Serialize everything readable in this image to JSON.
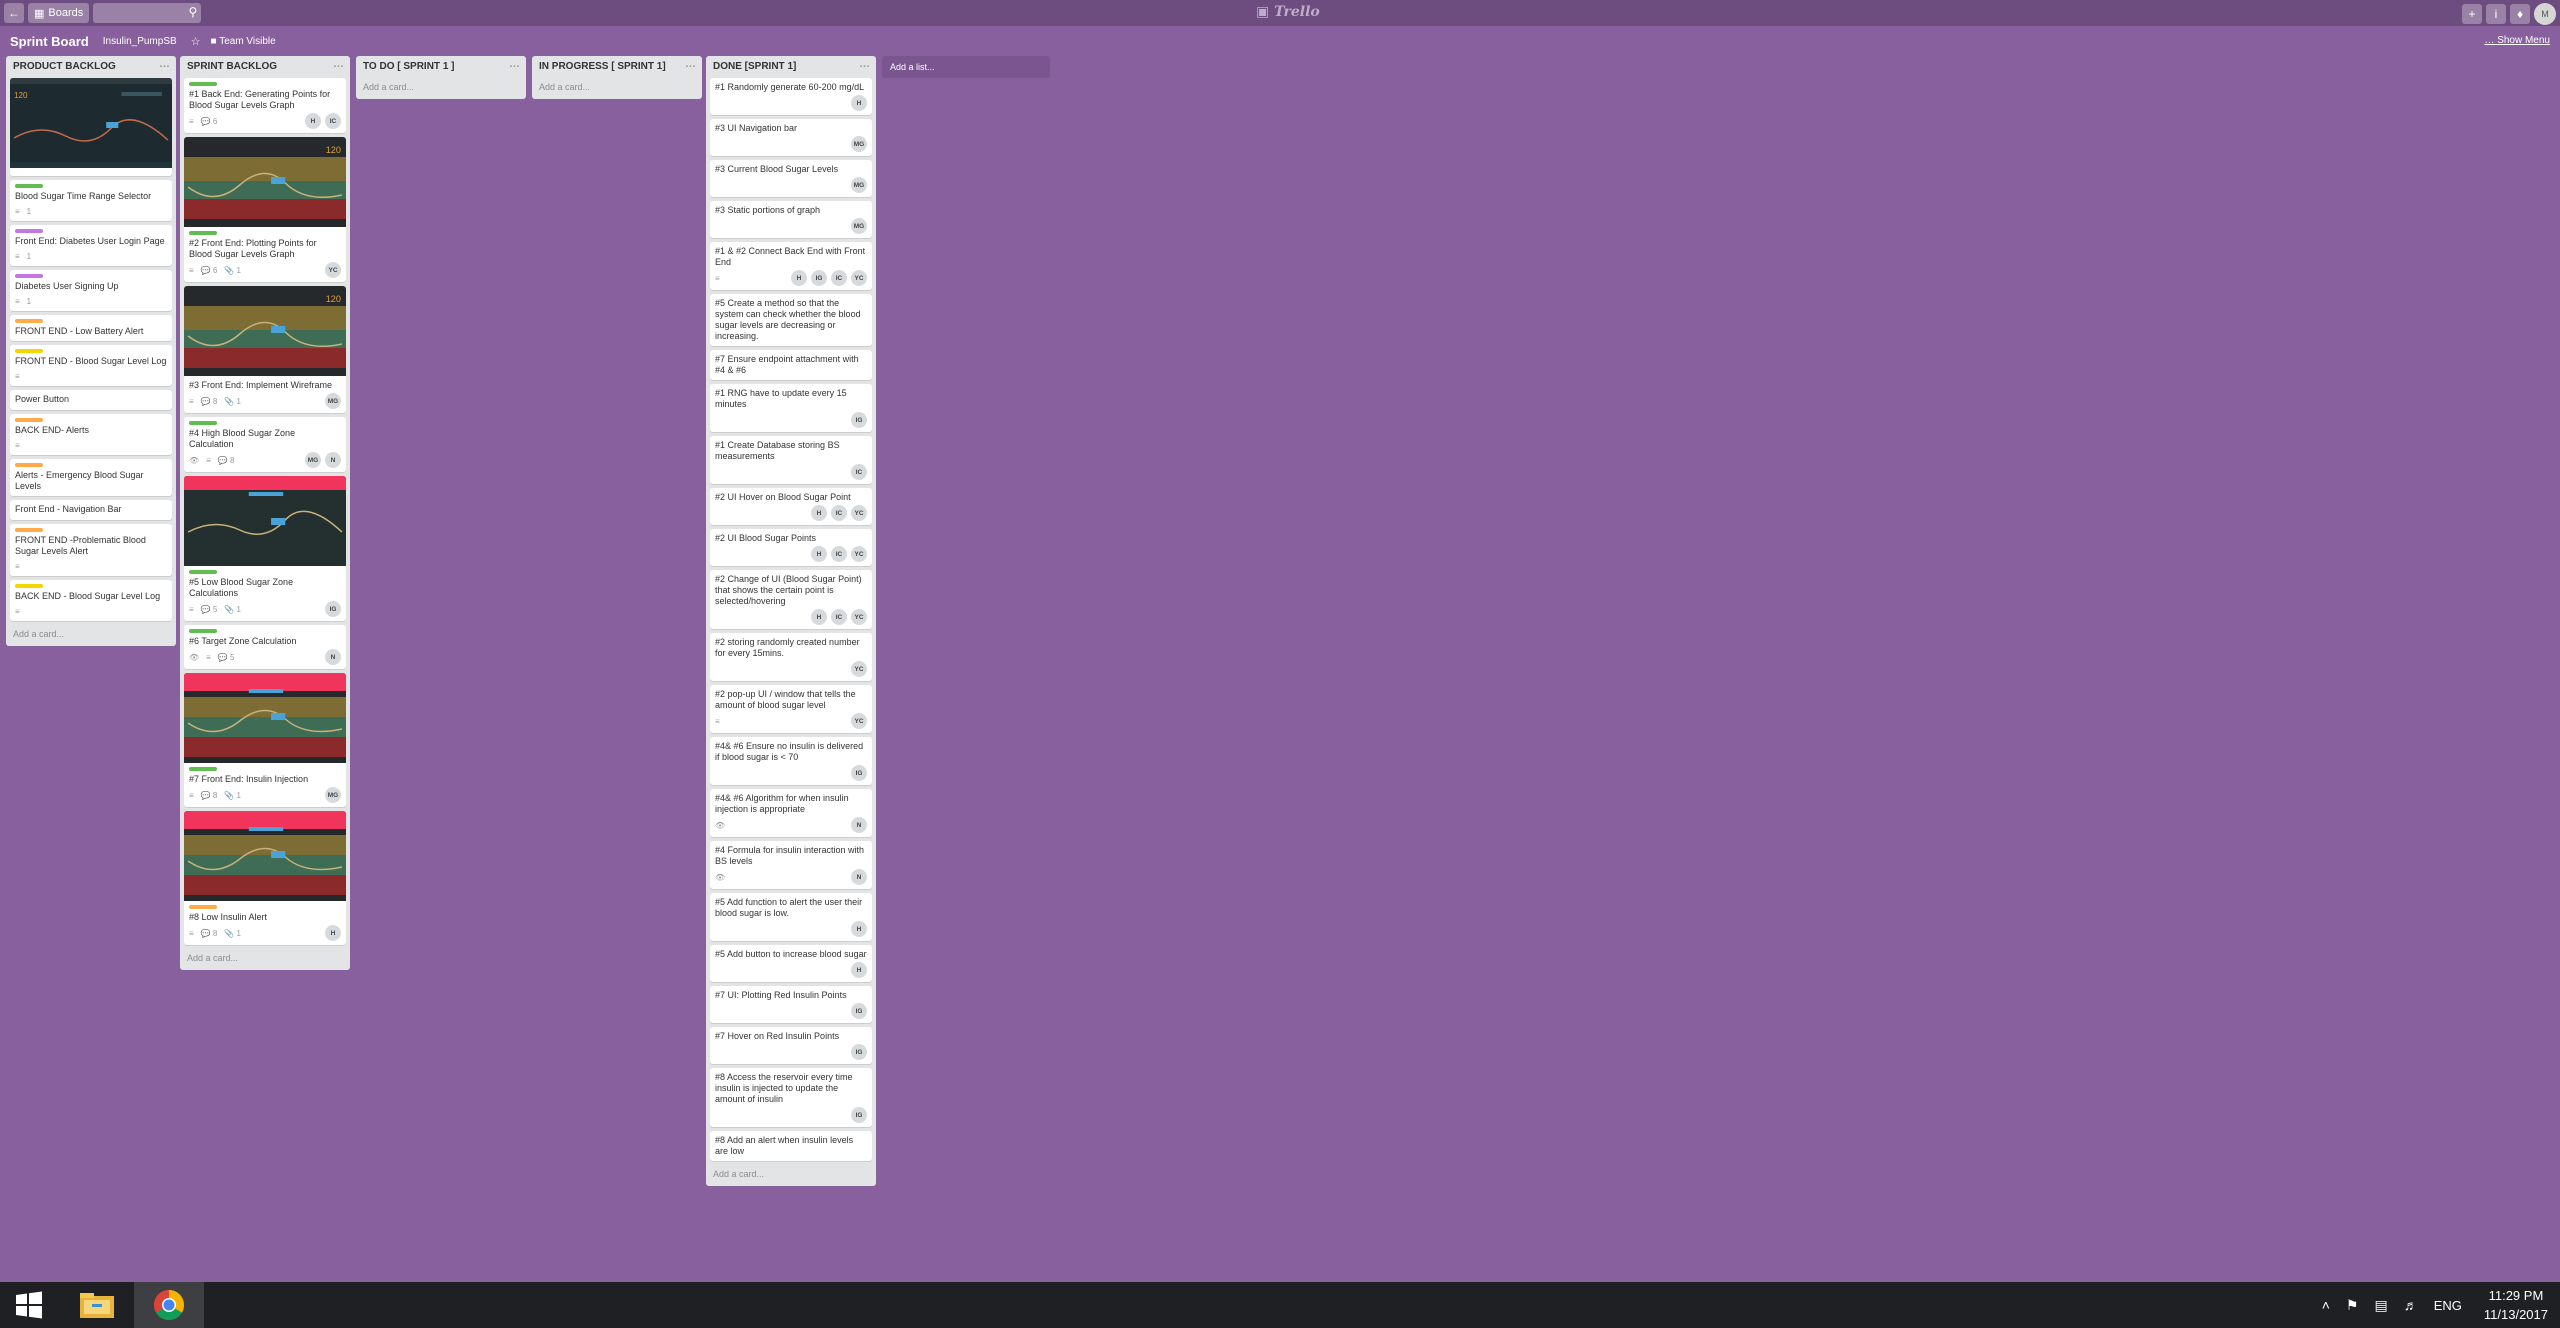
{
  "topbar": {
    "back_icon": "back-arrow-icon",
    "boards_label": "Boards",
    "logo_text": "Trello",
    "right_icons": [
      "plus-icon",
      "info-icon",
      "bell-icon"
    ],
    "avatar_initials": "M"
  },
  "board": {
    "title": "Sprint Board",
    "org": "Insulin_PumpSB",
    "visibility": "Team Visible",
    "show_menu": "Show Menu",
    "add_list": "Add a list..."
  },
  "lists": [
    {
      "title": "PRODUCT BACKLOG",
      "add_card": "Add a card...",
      "cards": [
        {
          "cover": "dark",
          "title": "",
          "labels": [],
          "badges": [],
          "members": []
        },
        {
          "labels": [
            "#61bd4f"
          ],
          "title": "Blood Sugar Time Range Selector",
          "badges": [
            "≡",
            "1"
          ],
          "members": []
        },
        {
          "labels": [
            "#c377e0"
          ],
          "title": "Front End: Diabetes User Login Page",
          "badges": [
            "≡",
            "1"
          ],
          "members": []
        },
        {
          "labels": [
            "#c377e0"
          ],
          "title": "Diabetes User Signing Up",
          "badges": [
            "≡",
            "1"
          ],
          "members": []
        },
        {
          "labels": [
            "#ffab4a"
          ],
          "title": "FRONT END - Low Battery Alert",
          "badges": [],
          "members": []
        },
        {
          "labels": [
            "#f2d600"
          ],
          "title": "FRONT END - Blood Sugar Level Log",
          "badges": [
            "≡"
          ],
          "members": []
        },
        {
          "labels": [],
          "title": "Power Button",
          "badges": [],
          "members": []
        },
        {
          "labels": [
            "#ffab4a"
          ],
          "title": "BACK END- Alerts",
          "badges": [
            "≡"
          ],
          "members": []
        },
        {
          "labels": [
            "#ffab4a"
          ],
          "title": "Alerts - Emergency Blood Sugar Levels",
          "badges": [],
          "members": []
        },
        {
          "labels": [],
          "title": "Front End - Navigation Bar",
          "badges": [],
          "members": []
        },
        {
          "labels": [
            "#ffab4a"
          ],
          "title": "FRONT END -Problematic Blood Sugar Levels Alert",
          "badges": [
            "≡"
          ],
          "members": []
        },
        {
          "labels": [
            "#f2d600"
          ],
          "title": "BACK END - Blood Sugar Level Log",
          "badges": [
            "≡"
          ],
          "members": []
        }
      ]
    },
    {
      "title": "SPRINT BACKLOG",
      "add_card": "Add a card...",
      "cards": [
        {
          "labels": [
            "#61bd4f"
          ],
          "title": "#1 Back End: Generating Points for Blood Sugar Levels Graph",
          "badges": [
            "≡",
            "💬 6"
          ],
          "members": [
            "H",
            "IC"
          ]
        },
        {
          "cover": "yellow",
          "labels": [
            "#61bd4f"
          ],
          "title": "#2 Front End: Plotting Points for Blood Sugar Levels Graph",
          "badges": [
            "≡",
            "💬 6",
            "📎 1"
          ],
          "members": [
            "YC"
          ]
        },
        {
          "cover": "yellow",
          "title": "#3 Front End: Implement Wireframe",
          "labels": [],
          "badges": [
            "≡",
            "💬 8",
            "📎 1"
          ],
          "members": [
            "MG"
          ]
        },
        {
          "labels": [
            "#61bd4f"
          ],
          "title": "#4 High Blood Sugar Zone Calculation",
          "badges": [
            "👁",
            "≡",
            "💬 8"
          ],
          "members": [
            "MG",
            "N"
          ]
        },
        {
          "cover": "red",
          "labels": [
            "#61bd4f"
          ],
          "title": "#5 Low Blood Sugar Zone Calculations",
          "badges": [
            "≡",
            "💬 5",
            "📎 1"
          ],
          "members": [
            "IG"
          ]
        },
        {
          "labels": [
            "#61bd4f"
          ],
          "title": "#6 Target Zone Calculation",
          "badges": [
            "👁",
            "≡",
            "💬 5"
          ],
          "members": [
            "N"
          ]
        },
        {
          "cover": "redgreen",
          "labels": [
            "#61bd4f"
          ],
          "title": "#7 Front End: Insulin Injection",
          "badges": [
            "≡",
            "💬 8",
            "📎 1"
          ],
          "members": [
            "MG"
          ]
        },
        {
          "cover": "redgreen",
          "labels": [
            "#ffab4a"
          ],
          "title": "#8 Low Insulin Alert",
          "badges": [
            "≡",
            "💬 8",
            "📎 1"
          ],
          "members": [
            "H"
          ]
        }
      ]
    },
    {
      "title": "TO DO [ SPRINT 1 ]",
      "add_card": "Add a card...",
      "cards": []
    },
    {
      "title": "IN PROGRESS [ SPRINT 1]",
      "add_card": "Add a card...",
      "cards": []
    },
    {
      "title": "DONE [SPRINT 1]",
      "add_card": "Add a card...",
      "cards": [
        {
          "labels": [],
          "title": "#1 Randomly generate 60-200 mg/dL",
          "badges": [],
          "members": [
            "H"
          ]
        },
        {
          "labels": [],
          "title": "#3 UI Navigation bar",
          "badges": [],
          "members": [
            "MG"
          ]
        },
        {
          "labels": [],
          "title": "#3 Current Blood Sugar Levels",
          "badges": [],
          "members": [
            "MG"
          ]
        },
        {
          "labels": [],
          "title": "#3 Static portions of graph",
          "badges": [],
          "members": [
            "MG"
          ]
        },
        {
          "labels": [],
          "title": "#1 & #2 Connect Back End with Front End",
          "badges": [
            "≡"
          ],
          "members": [
            "H",
            "IG",
            "IC",
            "YC"
          ]
        },
        {
          "labels": [],
          "title": "#5 Create a method so that the system can check whether the blood sugar levels are decreasing or increasing.",
          "badges": [],
          "members": []
        },
        {
          "labels": [],
          "title": "#7 Ensure endpoint attachment with #4 & #6",
          "badges": [],
          "members": []
        },
        {
          "labels": [],
          "title": "#1 RNG have to update every 15 minutes",
          "badges": [],
          "members": [
            "IG"
          ]
        },
        {
          "labels": [],
          "title": "#1 Create Database storing BS measurements",
          "badges": [],
          "members": [
            "IC"
          ]
        },
        {
          "labels": [],
          "title": "#2 UI Hover on Blood Sugar Point",
          "badges": [],
          "members": [
            "H",
            "IC",
            "YC"
          ]
        },
        {
          "labels": [],
          "title": "#2 UI Blood Sugar Points",
          "badges": [],
          "members": [
            "H",
            "IC",
            "YC"
          ]
        },
        {
          "labels": [],
          "title": "#2 Change of UI (Blood Sugar Point) that shows the certain point is selected/hovering",
          "badges": [],
          "members": [
            "H",
            "IC",
            "YC"
          ]
        },
        {
          "labels": [],
          "title": "#2 storing randomly created number for every 15mins.",
          "badges": [],
          "members": [
            "YC"
          ]
        },
        {
          "labels": [],
          "title": "#2 pop-up UI / window that tells the amount of blood sugar level",
          "badges": [
            "≡"
          ],
          "members": [
            "YC"
          ]
        },
        {
          "labels": [],
          "title": "#4& #6 Ensure no insulin is delivered if blood sugar is < 70",
          "badges": [],
          "members": [
            "IG"
          ]
        },
        {
          "labels": [],
          "title": "#4& #6 Algorithm for when insulin injection is appropriate",
          "badges": [
            "👁"
          ],
          "members": [
            "N"
          ]
        },
        {
          "labels": [],
          "title": "#4 Formula for insulin interaction with BS levels",
          "badges": [
            "👁"
          ],
          "members": [
            "N"
          ]
        },
        {
          "labels": [],
          "title": "#5 Add function to alert the user their blood sugar is low.",
          "badges": [],
          "members": [
            "H"
          ]
        },
        {
          "labels": [],
          "title": "#5 Add button to increase blood sugar",
          "badges": [],
          "members": [
            "H"
          ]
        },
        {
          "labels": [],
          "title": "#7 UI: Plotting Red Insulin Points",
          "badges": [],
          "members": [
            "IG"
          ]
        },
        {
          "labels": [],
          "title": "#7 Hover on Red Insulin Points",
          "badges": [],
          "members": [
            "IG"
          ]
        },
        {
          "labels": [],
          "title": "#8 Access the reservoir every time insulin is injected to update the amount of insulin",
          "badges": [],
          "members": [
            "IG"
          ]
        },
        {
          "labels": [],
          "title": "#8 Add an alert when insulin levels are low",
          "badges": [],
          "members": []
        }
      ]
    }
  ],
  "taskbar": {
    "start_icon": "windows-logo-icon",
    "apps": [
      "file-explorer-icon",
      "chrome-icon"
    ],
    "tray_icons": [
      "chevron-up-icon",
      "flag-icon",
      "network-icon",
      "volume-icon"
    ],
    "lang": "ENG",
    "time": "11:29 PM",
    "date": "11/13/2017"
  },
  "colors": {
    "board_bg": "#89609e",
    "topbar_bg": "#6d4c80",
    "list_bg": "#e2e4e6",
    "label_green": "#61bd4f",
    "label_purple": "#c377e0",
    "label_orange": "#ffab4a",
    "label_yellow": "#f2d600",
    "taskbar_bg": "#1e2023"
  }
}
